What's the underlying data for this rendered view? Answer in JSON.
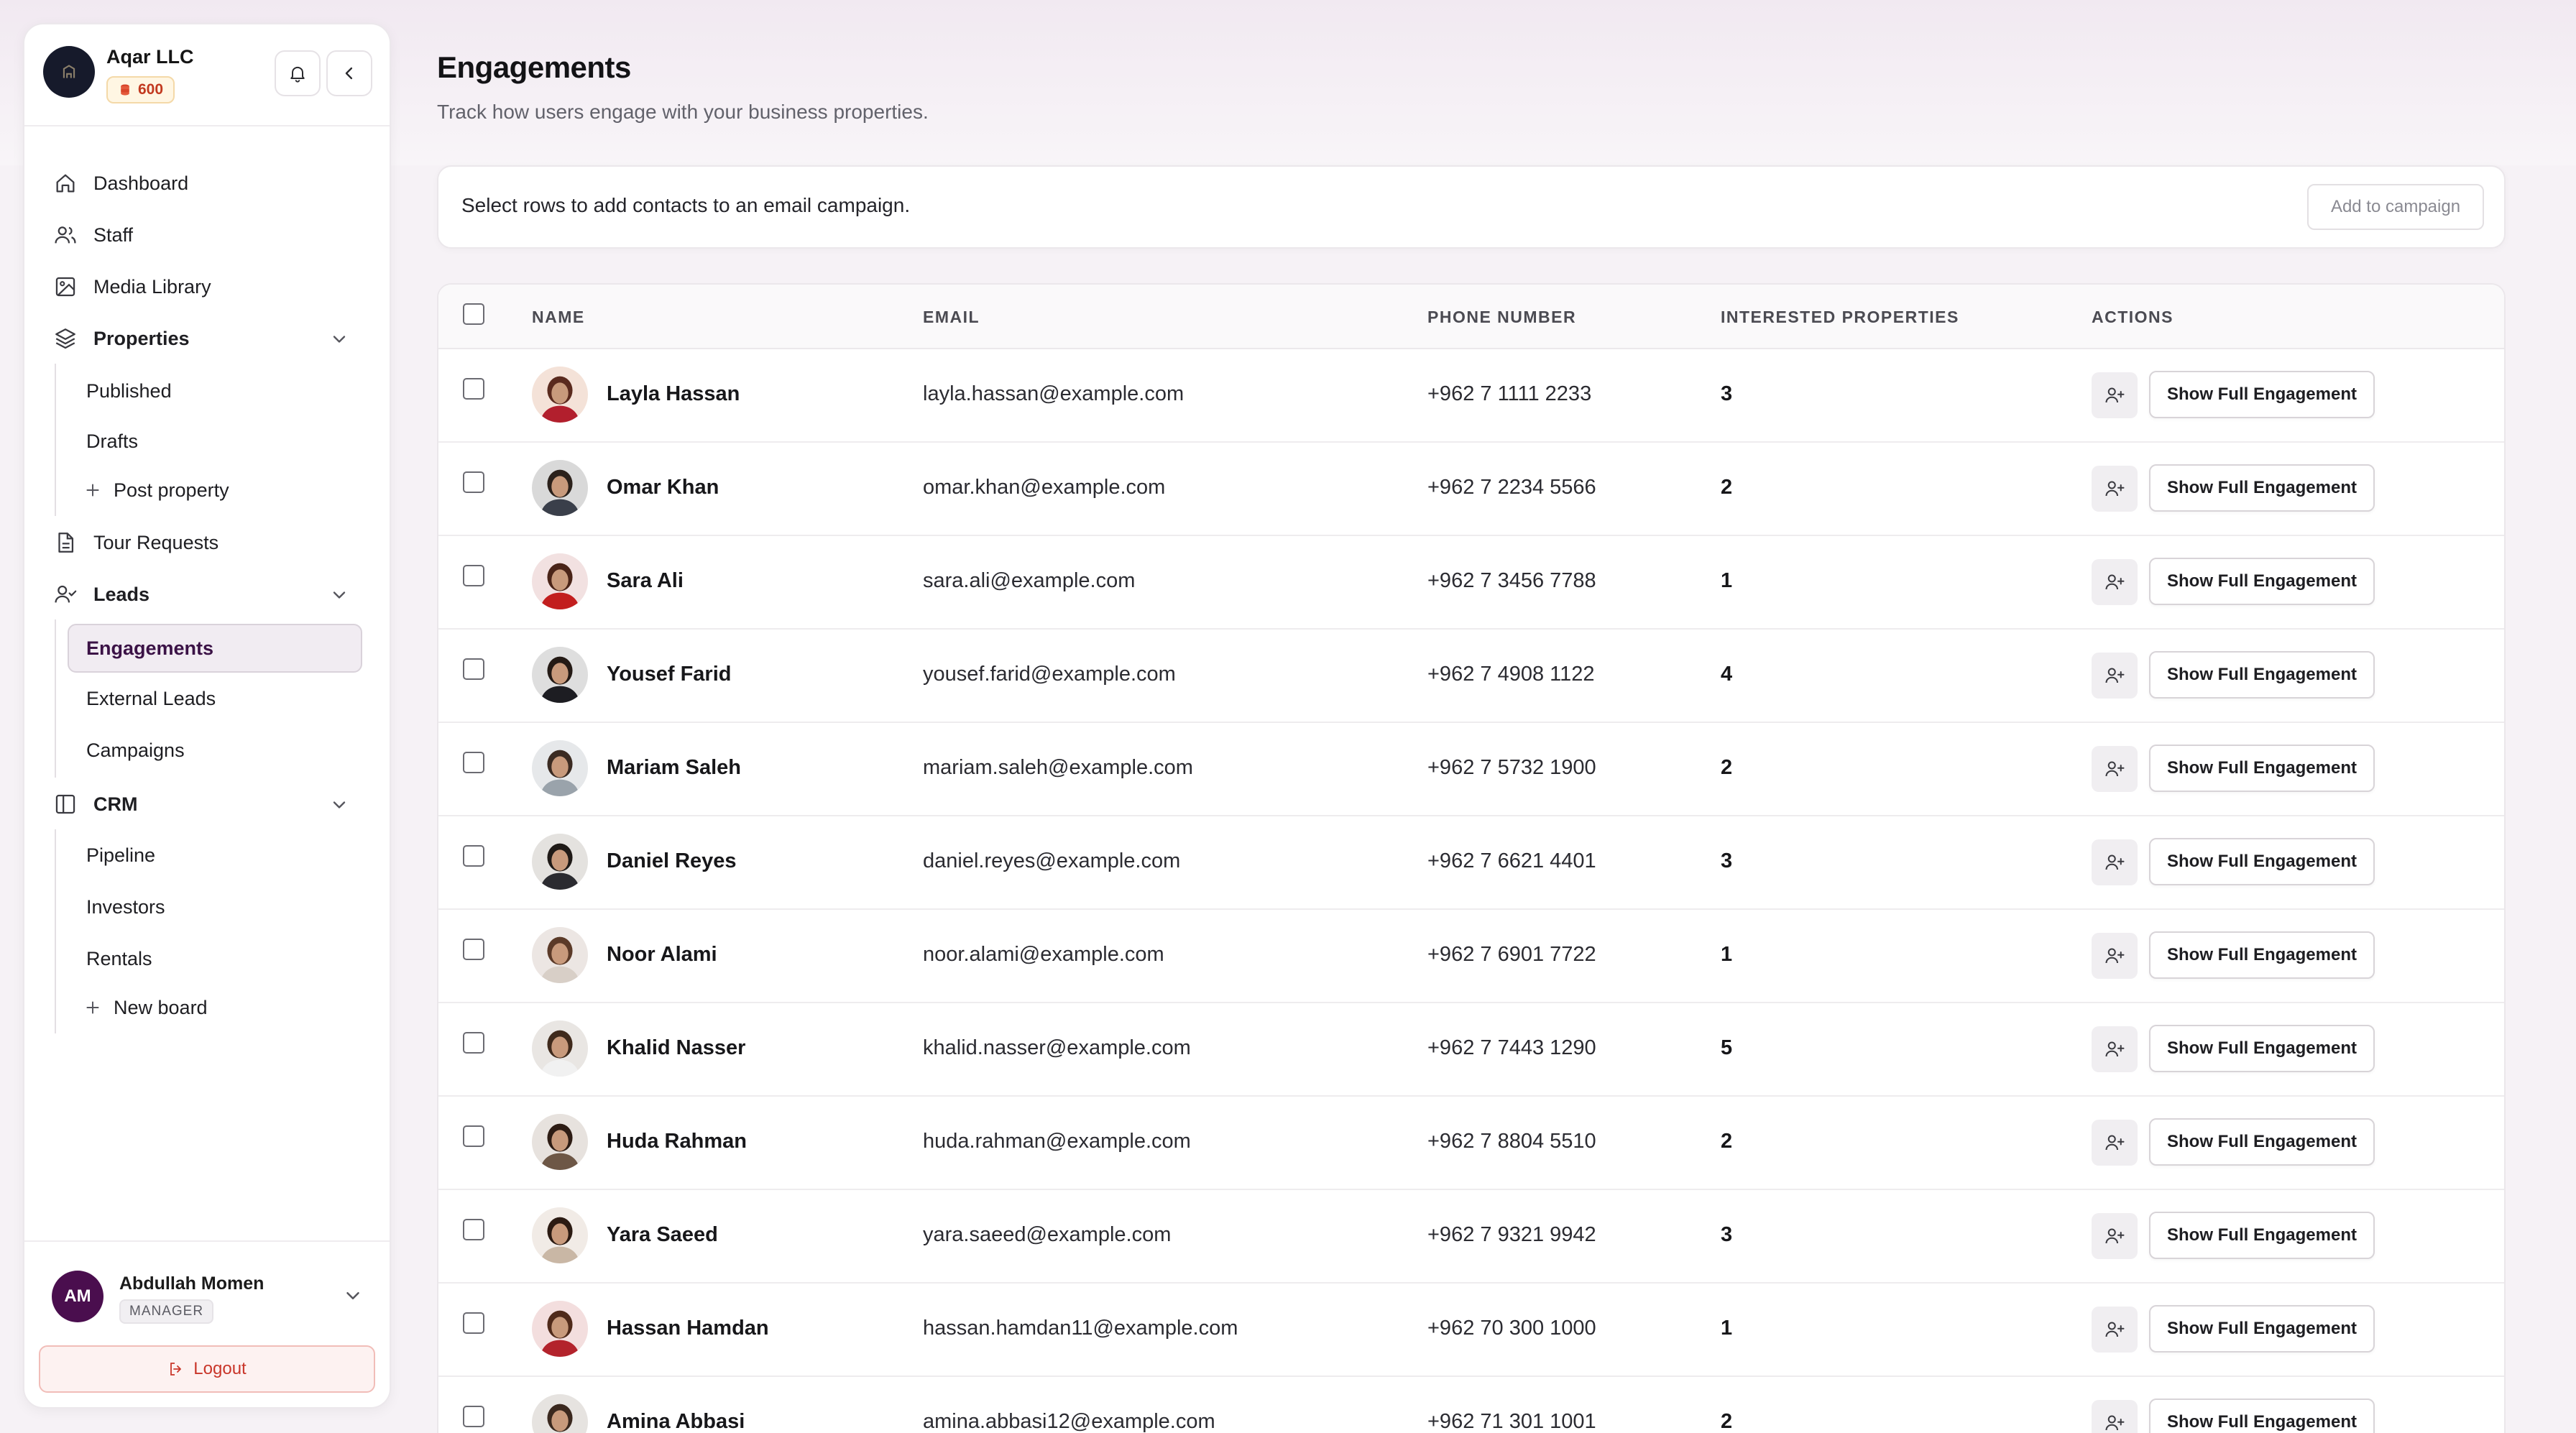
{
  "org": {
    "name": "Aqar LLC",
    "credits": "600"
  },
  "nav": {
    "dashboard": "Dashboard",
    "staff": "Staff",
    "media_library": "Media Library",
    "properties": "Properties",
    "properties_sub": [
      "Published",
      "Drafts"
    ],
    "post_property": "Post property",
    "tour_requests": "Tour Requests",
    "leads": "Leads",
    "leads_sub": [
      "Engagements",
      "External Leads",
      "Campaigns"
    ],
    "crm": "CRM",
    "crm_sub": [
      "Pipeline",
      "Investors",
      "Rentals"
    ],
    "new_board": "New board"
  },
  "user": {
    "initials": "AM",
    "name": "Abdullah Momen",
    "role": "MANAGER",
    "logout_label": "Logout"
  },
  "page": {
    "title": "Engagements",
    "subtitle": "Track how users engage with your business properties."
  },
  "campaign": {
    "text": "Select rows to add contacts to an email campaign.",
    "button_label": "Add to campaign"
  },
  "table": {
    "headers": {
      "name": "NAME",
      "email": "EMAIL",
      "phone": "PHONE NUMBER",
      "interested": "INTERESTED PROPERTIES",
      "actions": "ACTIONS"
    },
    "action_label": "Show Full Engagement",
    "rows": [
      {
        "name": "Layla Hassan",
        "email": "layla.hassan@example.com",
        "phone": "+962 7 1111 2233",
        "interested": "3"
      },
      {
        "name": "Omar Khan",
        "email": "omar.khan@example.com",
        "phone": "+962 7 2234 5566",
        "interested": "2"
      },
      {
        "name": "Sara Ali",
        "email": "sara.ali@example.com",
        "phone": "+962 7 3456 7788",
        "interested": "1"
      },
      {
        "name": "Yousef Farid",
        "email": "yousef.farid@example.com",
        "phone": "+962 7 4908 1122",
        "interested": "4"
      },
      {
        "name": "Mariam Saleh",
        "email": "mariam.saleh@example.com",
        "phone": "+962 7 5732 1900",
        "interested": "2"
      },
      {
        "name": "Daniel Reyes",
        "email": "daniel.reyes@example.com",
        "phone": "+962 7 6621 4401",
        "interested": "3"
      },
      {
        "name": "Noor Alami",
        "email": "noor.alami@example.com",
        "phone": "+962 7 6901 7722",
        "interested": "1"
      },
      {
        "name": "Khalid Nasser",
        "email": "khalid.nasser@example.com",
        "phone": "+962 7 7443 1290",
        "interested": "5"
      },
      {
        "name": "Huda Rahman",
        "email": "huda.rahman@example.com",
        "phone": "+962 7 8804 5510",
        "interested": "2"
      },
      {
        "name": "Yara Saeed",
        "email": "yara.saeed@example.com",
        "phone": "+962 7 9321 9942",
        "interested": "3"
      },
      {
        "name": "Hassan Hamdan",
        "email": "hassan.hamdan11@example.com",
        "phone": "+962 70 300 1000",
        "interested": "1"
      },
      {
        "name": "Amina Abbasi",
        "email": "amina.abbasi12@example.com",
        "phone": "+962 71 301 1001",
        "interested": "2"
      }
    ]
  },
  "colors": {
    "accent": "#4a0e4e",
    "active_bg": "#f1ecf2",
    "logout": "#c9362a",
    "credits": "#c2391f"
  },
  "icons": [
    "org-logo",
    "coins-icon",
    "bell-icon",
    "chevron-left-icon",
    "home-icon",
    "users-icon",
    "image-icon",
    "layers-icon",
    "chevron-down-icon",
    "plus-icon",
    "file-icon",
    "user-check-icon",
    "columns-icon",
    "logout-icon",
    "user-plus-icon"
  ]
}
